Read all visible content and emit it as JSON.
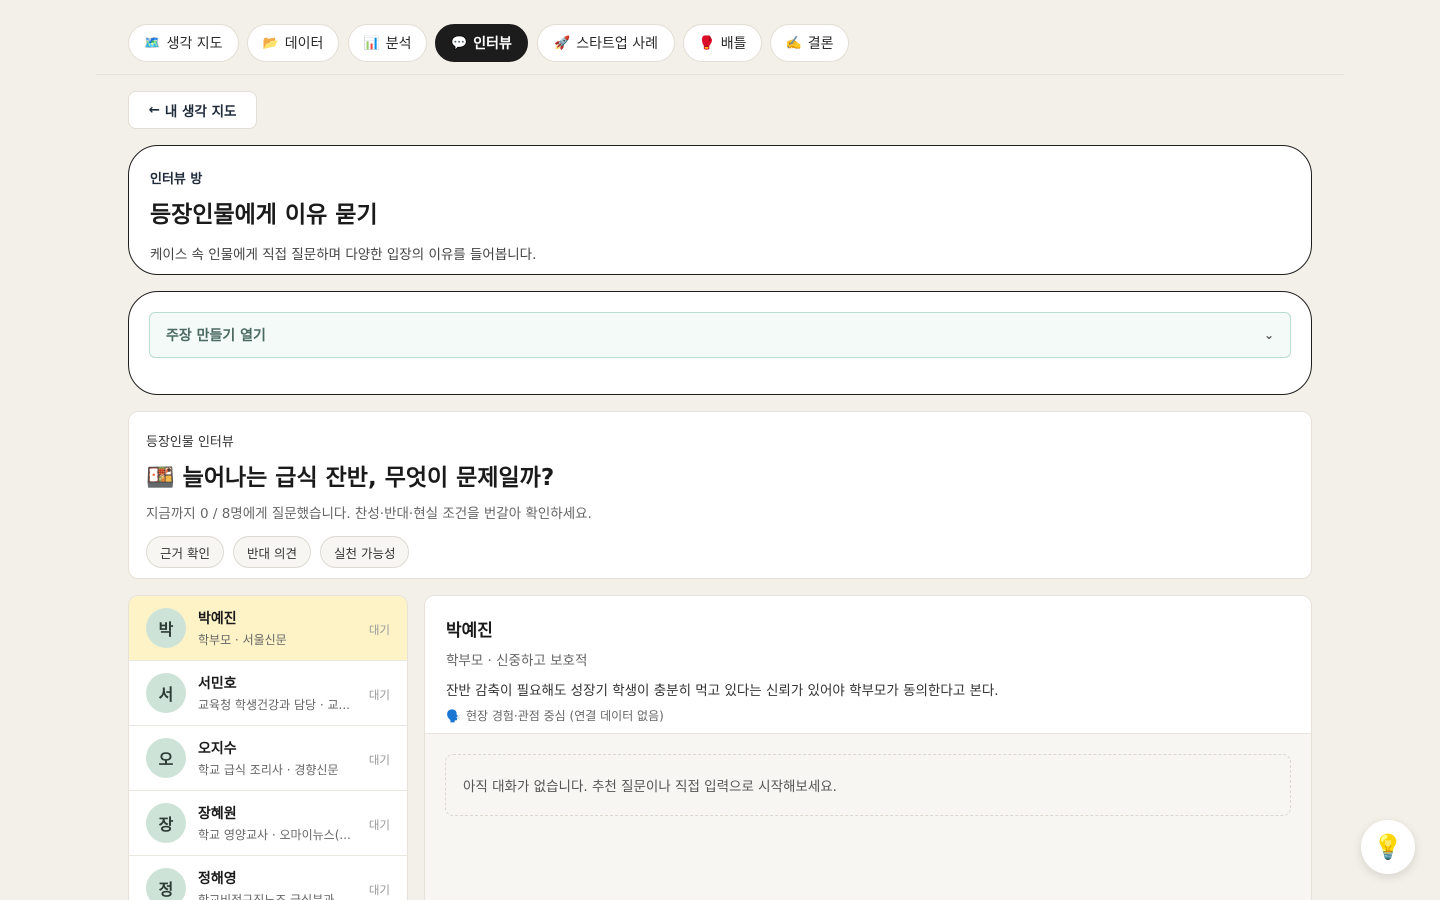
{
  "nav": {
    "tabs": [
      {
        "icon": "🗺️",
        "label": "생각 지도"
      },
      {
        "icon": "📂",
        "label": "데이터"
      },
      {
        "icon": "📊",
        "label": "분석"
      },
      {
        "icon": "💬",
        "label": "인터뷰"
      },
      {
        "icon": "🚀",
        "label": "스타트업 사례"
      },
      {
        "icon": "🥊",
        "label": "배틀"
      },
      {
        "icon": "✍️",
        "label": "결론"
      }
    ],
    "active": "인터뷰"
  },
  "back": {
    "arrow": "←",
    "label": "내 생각 지도"
  },
  "hero": {
    "eyebrow": "인터뷰 방",
    "title": "등장인물에게 이유 묻기",
    "description": "케이스 속 인물에게 직접 질문하며 다양한 입장의 이유를 들어봅니다."
  },
  "claim": {
    "label": "주장 만들기 열기",
    "chevron": "⌄"
  },
  "interview": {
    "eyebrow": "등장인물 인터뷰",
    "icon": "🍱",
    "title": "늘어나는 급식 잔반, 무엇이 문제일까?",
    "progress": "지금까지 0 / 8명에게 질문했습니다. 찬성·반대·현실 조건을 번갈아 확인하세요.",
    "chips": [
      "근거 확인",
      "반대 의견",
      "실천 가능성"
    ]
  },
  "people": [
    {
      "initial": "박",
      "name": "박예진",
      "role": "학부모 · 서울신문",
      "status": "대기"
    },
    {
      "initial": "서",
      "name": "서민호",
      "role": "교육청 학생건강과 담당 · 교...",
      "status": "대기"
    },
    {
      "initial": "오",
      "name": "오지수",
      "role": "학교 급식 조리사 · 경향신문",
      "status": "대기"
    },
    {
      "initial": "장",
      "name": "장혜원",
      "role": "학교 영양교사 · 오마이뉴스(...",
      "status": "대기"
    },
    {
      "initial": "정",
      "name": "정해영",
      "role": "학교비정규직노조 급식분과...",
      "status": "대기"
    }
  ],
  "detail": {
    "name": "박예진",
    "role": "학부모 · 신중하고 보호적",
    "stance": "잔반 감축이 필요해도 성장기 학생이 충분히 먹고 있다는 신뢰가 있어야 학부모가 동의한다고 본다.",
    "source_icon": "🗣️",
    "source": "현장 경험·관점 중심 (연결 데이터 없음)",
    "empty": "아직 대화가 없습니다. 추천 질문이나 직접 입력으로 시작해보세요."
  },
  "fab": {
    "icon": "💡"
  }
}
